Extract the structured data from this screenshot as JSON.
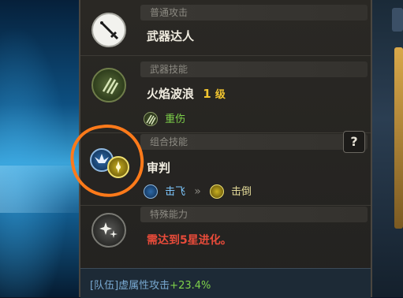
{
  "skills": [
    {
      "category": "普通攻击",
      "name": "武器达人",
      "icon": "sword-icon"
    },
    {
      "category": "武器技能",
      "name": "火焰波浪",
      "level": "1",
      "level_unit": "级",
      "icon": "claw-slash-icon",
      "effect": {
        "icon": "claw-slash-icon",
        "label": "重伤"
      }
    },
    {
      "category": "组合技能",
      "name": "审判",
      "icon": "combo-icon",
      "chain": [
        {
          "icon": "wing-emblem-icon",
          "label": "击飞"
        },
        {
          "icon": "knockdown-icon",
          "label": "击倒"
        }
      ]
    },
    {
      "category": "特殊能力",
      "name": "",
      "requirement": "需达到5星进化。",
      "icon": "sparkle-icon"
    }
  ],
  "help_label": "?",
  "team_bonus": {
    "prefix": "[队伍]",
    "text": "虚属性攻击",
    "value": "+23.4%"
  },
  "colors": {
    "level": "#f2c530",
    "effect": "#7ed24a",
    "requirement": "#e84b3a",
    "team": "#78a8d0",
    "annotation": "#ff7a1a"
  }
}
